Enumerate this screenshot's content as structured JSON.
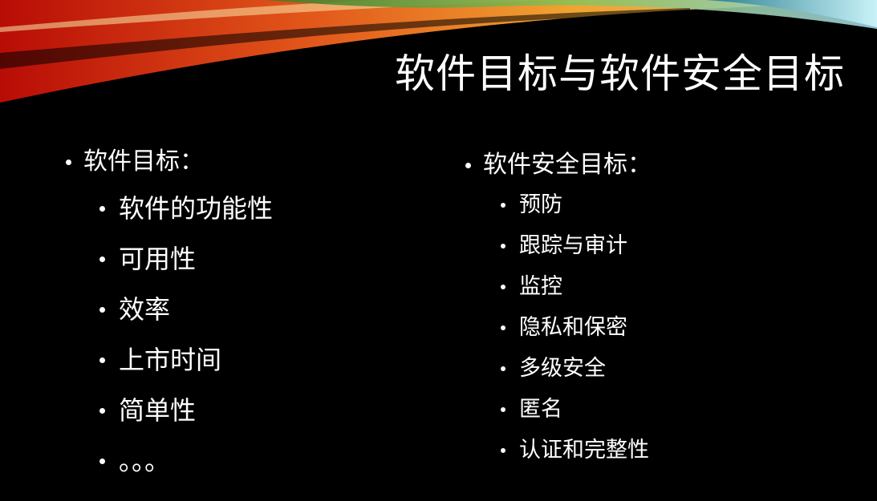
{
  "slide": {
    "title": "软件目标与软件安全目标",
    "left": {
      "heading": "软件目标：",
      "items": [
        "软件的功能性",
        "可用性",
        "效率",
        "上市时间",
        "简单性",
        "。。。"
      ]
    },
    "right": {
      "heading": "软件安全目标：",
      "items": [
        "预防",
        "跟踪与审计",
        "监控",
        "隐私和保密",
        "多级安全",
        "匿名",
        "认证和完整性"
      ]
    }
  }
}
